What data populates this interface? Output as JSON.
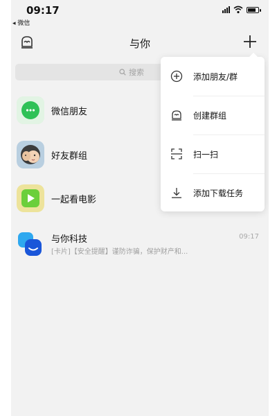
{
  "status_bar": {
    "time": "09:17",
    "back_label": "◂ 微信"
  },
  "nav": {
    "title": "与你"
  },
  "search": {
    "placeholder": "搜索"
  },
  "chats": [
    {
      "name": "微信朋友",
      "icon": "wechat-chat-icon",
      "color": "#2fc157"
    },
    {
      "name": "好友群组",
      "icon": "group-avatar-icon",
      "color": "#b9cfe0"
    },
    {
      "name": "一起看电影",
      "icon": "play-icon",
      "color": "#6bcf3b"
    },
    {
      "name": "与你科技",
      "icon": "yuni-logo-icon",
      "color": "#1a73e8",
      "time": "09:17",
      "preview": "[卡片]【安全提醒】谨防诈骗，保护财产和..."
    }
  ],
  "menu": {
    "items": [
      {
        "label": "添加朋友/群",
        "icon": "add-circle-icon"
      },
      {
        "label": "创建群组",
        "icon": "create-group-icon"
      },
      {
        "label": "扫一扫",
        "icon": "scan-icon"
      },
      {
        "label": "添加下载任务",
        "icon": "download-icon"
      }
    ]
  }
}
